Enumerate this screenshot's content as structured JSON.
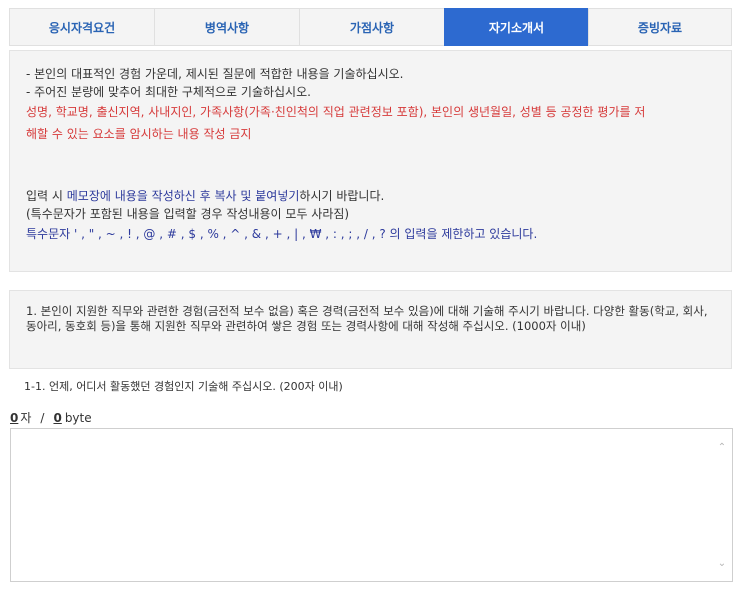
{
  "tabs": [
    {
      "label": "응시자격요건",
      "active": false
    },
    {
      "label": "병역사항",
      "active": false
    },
    {
      "label": "가점사항",
      "active": false
    },
    {
      "label": "자기소개서",
      "active": true
    },
    {
      "label": "증빙자료",
      "active": false
    }
  ],
  "guide": {
    "line1": "- 본인의 대표적인 경험 가운데, 제시된 질문에 적합한 내용을 기술하십시오.",
    "line2": "- 주어진 분량에 맞추어 최대한 구체적으로 기술하십시오.",
    "warning_line1": "성명, 학교명, 출신지역, 사내지인, 가족사항(가족·친인척의 직업 관련정보 포함), 본인의 생년월일, 성별 등 공정한 평가를 저",
    "warning_line2": "해할 수 있는 요소를 암시하는 내용 작성 금지",
    "input_prefix": "입력 시 ",
    "input_memo": "메모장에 내용을 작성하신 후 복사 및 붙여넣기",
    "input_suffix": "하시기 바랍니다.",
    "special_note": "(특수문자가 포함된 내용을 입력할 경우 작성내용이 모두 사라짐)",
    "special_chars": "특수문자 ' , \" , ~ , ! , @ , # , $ , % , ^ , & , + , | , ₩ , : , ; , / , ? 의 입력을 제한하고 있습니다."
  },
  "question": {
    "text": "1. 본인이 지원한 직무와 관련한 경험(금전적 보수 없음) 혹은 경력(금전적 보수 있음)에 대해 기술해 주시기 바랍니다. 다양한 활동(학교, 회사, 동아리, 동호회 등)을 통해 지원한 직무와 관련하여 쌓은 경험 또는 경력사항에 대해 작성해 주십시오. (1000자 이내)"
  },
  "subquestion": {
    "text": "1-1. 언제, 어디서 활동했던 경험인지 기술해 주십시오. (200자 이내)"
  },
  "counter": {
    "chars": "0",
    "chars_unit": "자",
    "separator": "/",
    "bytes": "0",
    "bytes_unit": "byte"
  },
  "answer": {
    "value": ""
  },
  "colors": {
    "active_tab": "#2d6ad0",
    "tab_text": "#2a64b4",
    "warning": "#d63a3a",
    "highlight": "#2d3a9c"
  }
}
